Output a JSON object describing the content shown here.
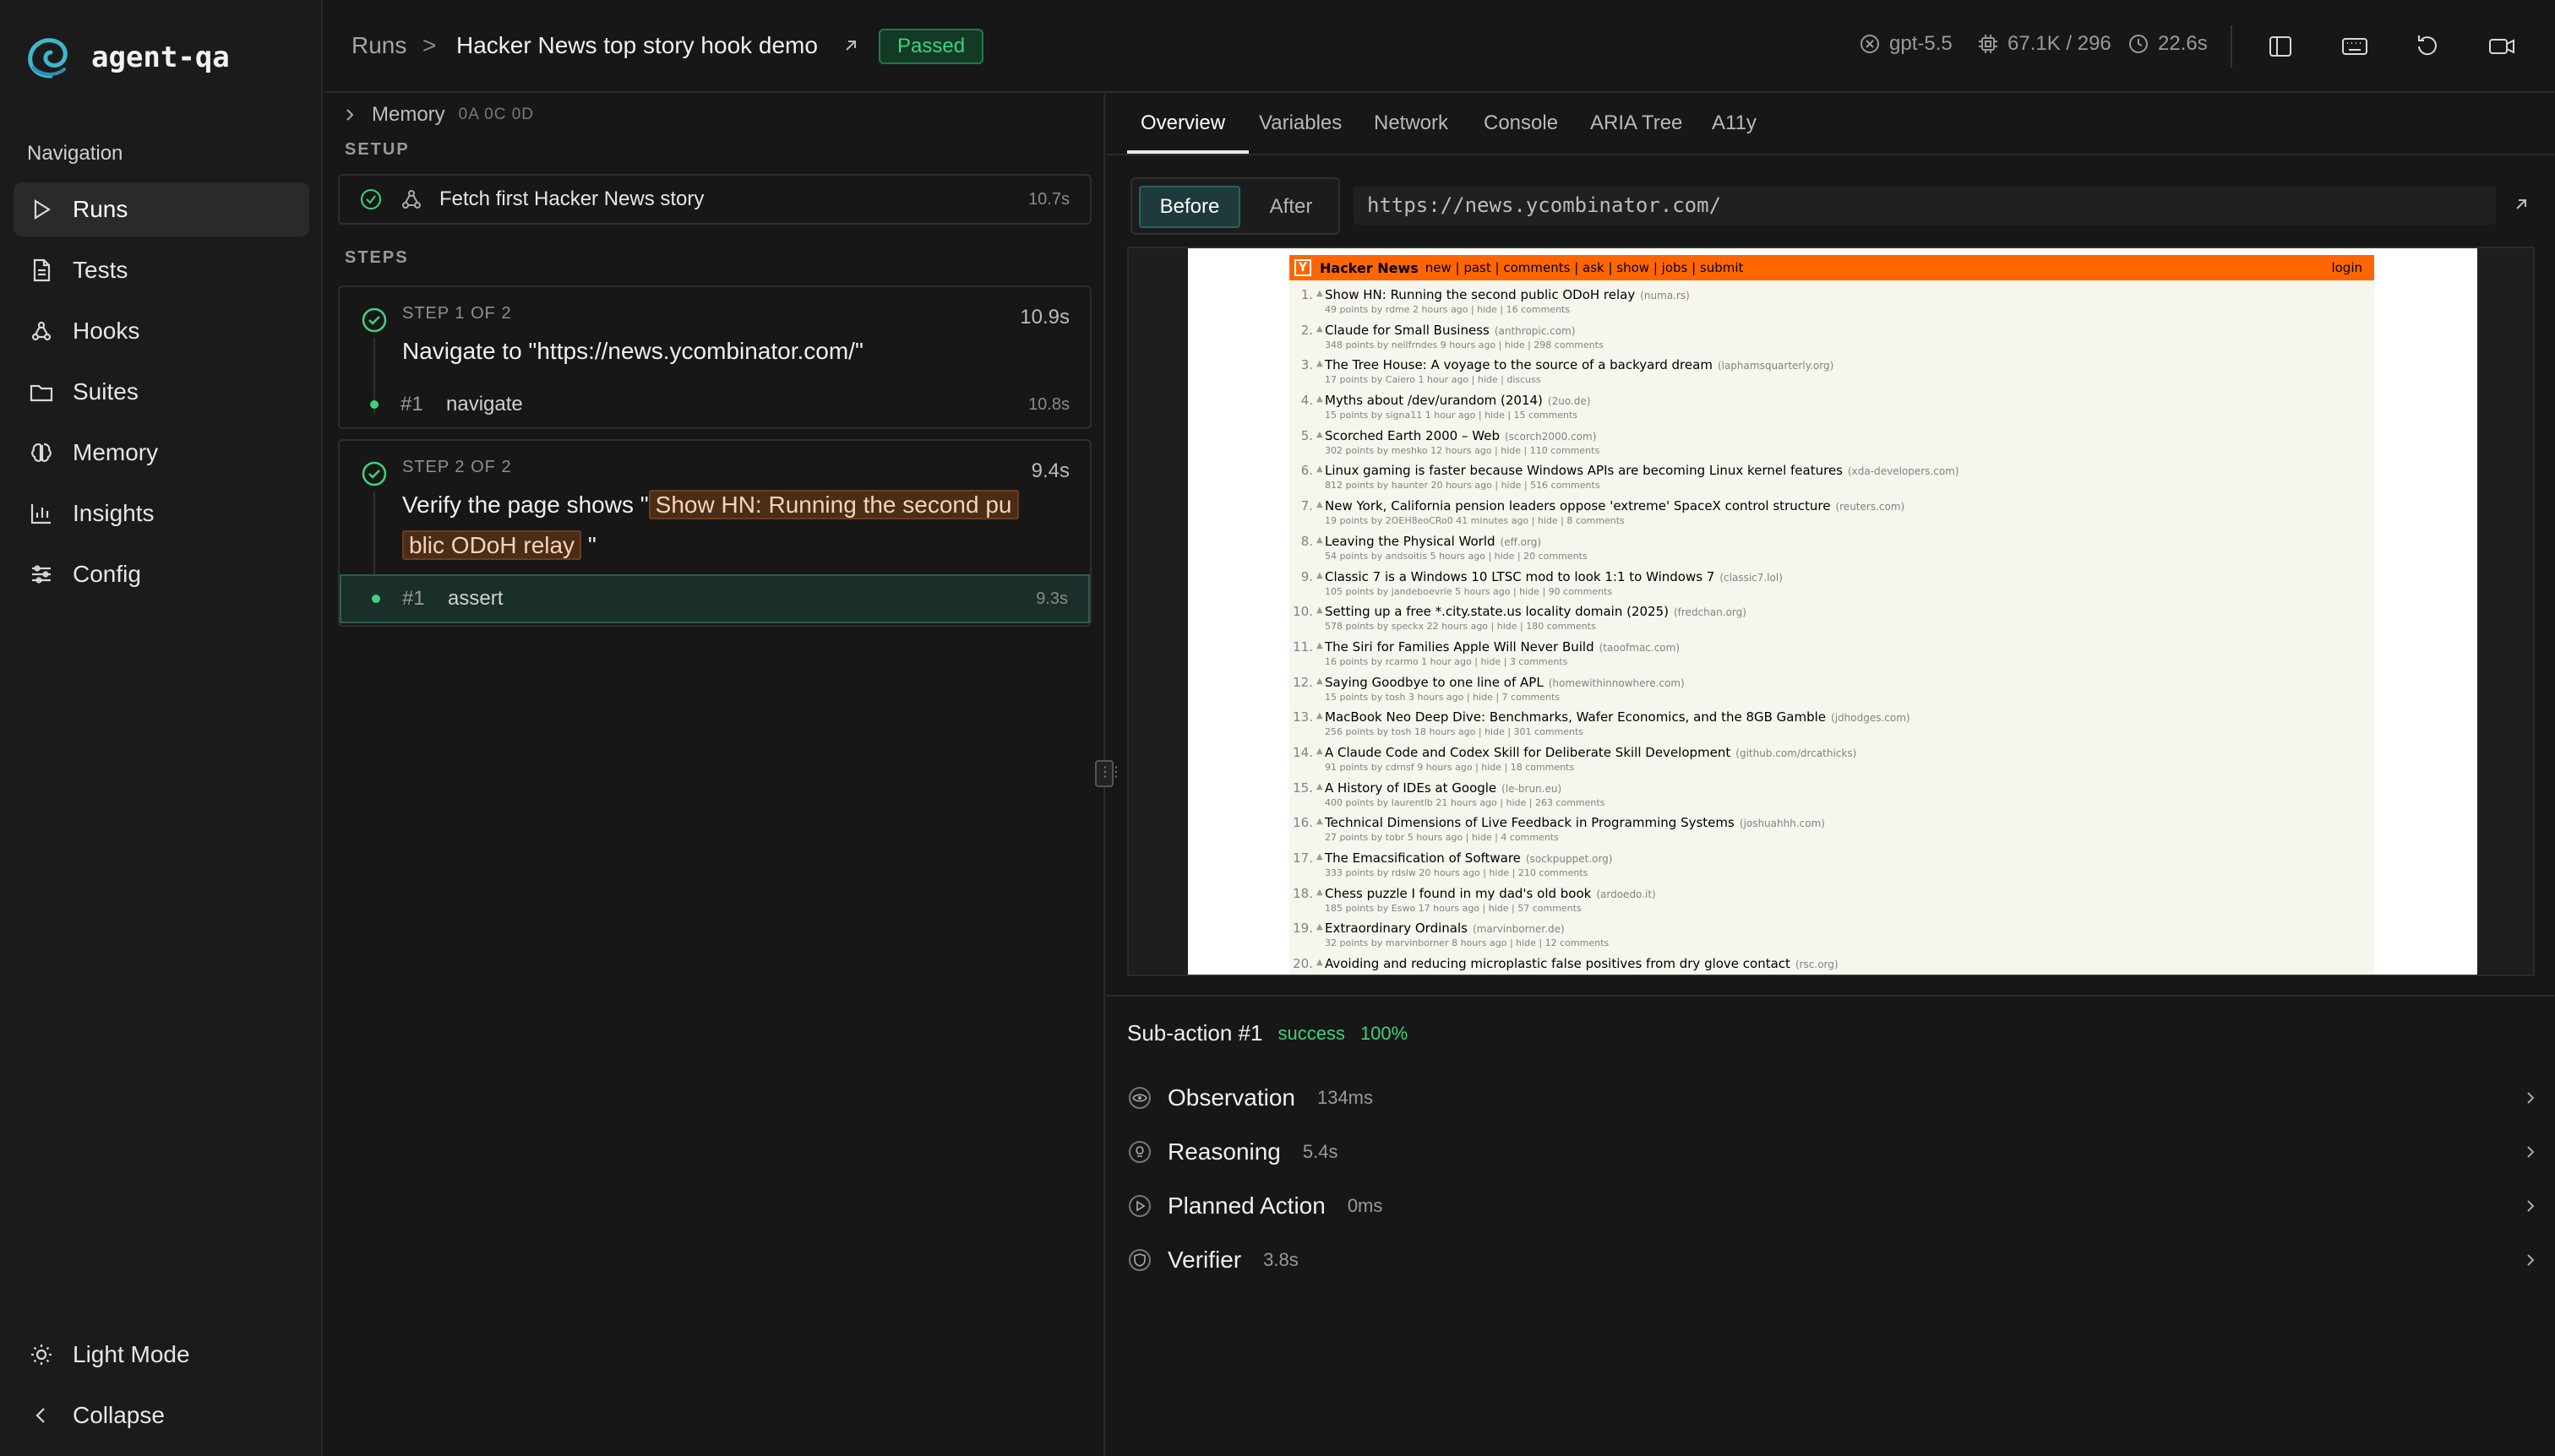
{
  "app": {
    "name": "agent-qa"
  },
  "sidebar": {
    "heading": "Navigation",
    "items": [
      {
        "label": "Runs",
        "icon": "play-icon",
        "active": true
      },
      {
        "label": "Tests",
        "icon": "file-icon"
      },
      {
        "label": "Hooks",
        "icon": "webhook-icon"
      },
      {
        "label": "Suites",
        "icon": "folder-icon"
      },
      {
        "label": "Memory",
        "icon": "brain-icon"
      },
      {
        "label": "Insights",
        "icon": "bar-chart-icon"
      },
      {
        "label": "Config",
        "icon": "sliders-icon"
      }
    ],
    "bottom": {
      "theme_label": "Light Mode",
      "collapse_label": "Collapse"
    }
  },
  "header": {
    "breadcrumb_root": "Runs",
    "breadcrumb_sep": ">",
    "title": "Hacker News top story hook demo",
    "status": "Passed",
    "model": "gpt-5.5",
    "tokens": "67.1K / 296",
    "duration": "22.6s"
  },
  "steps_panel": {
    "memory": {
      "label": "Memory",
      "ids": "0A 0C 0D"
    },
    "setup_label": "SETUP",
    "setup_item": {
      "label": "Fetch first Hacker News story",
      "time": "10.7s"
    },
    "steps_label": "STEPS",
    "steps": [
      {
        "label": "STEP 1 OF 2",
        "time": "10.9s",
        "title": "Navigate to \"https://news.ycombinator.com/\"",
        "sub": {
          "num": "#1",
          "name": "navigate",
          "time": "10.8s"
        }
      },
      {
        "label": "STEP 2 OF 2",
        "time": "9.4s",
        "title_prefix": "Verify the page shows \"",
        "title_highlight_1": "Show HN: Running the second pu",
        "title_highlight_2": "blic ODoH relay",
        "title_suffix": "\"",
        "sub": {
          "num": "#1",
          "name": "assert",
          "time": "9.3s"
        }
      }
    ]
  },
  "right_panel": {
    "tabs": [
      "Overview",
      "Variables",
      "Network",
      "Console",
      "ARIA Tree",
      "A11y"
    ],
    "before_label": "Before",
    "after_label": "After",
    "url": "https://news.ycombinator.com/",
    "hn": {
      "brand": "Hacker News",
      "links": "new | past | comments | ask | show | jobs | submit",
      "login": "login",
      "items": [
        {
          "rank": "1.",
          "title": "Show HN: Running the second public ODoH relay",
          "site": "(numa.rs)",
          "sub": "49 points by rdme 2 hours ago | hide | 16 comments"
        },
        {
          "rank": "2.",
          "title": "Claude for Small Business",
          "site": "(anthropic.com)",
          "sub": "348 points by neilfrndes 9 hours ago | hide | 298 comments"
        },
        {
          "rank": "3.",
          "title": "The Tree House: A voyage to the source of a backyard dream",
          "site": "(laphamsquarterly.org)",
          "sub": "17 points by Caiero 1 hour ago | hide | discuss"
        },
        {
          "rank": "4.",
          "title": "Myths about /dev/urandom (2014)",
          "site": "(2uo.de)",
          "sub": "15 points by signa11 1 hour ago | hide | 15 comments"
        },
        {
          "rank": "5.",
          "title": "Scorched Earth 2000 – Web",
          "site": "(scorch2000.com)",
          "sub": "302 points by meshko 12 hours ago | hide | 110 comments"
        },
        {
          "rank": "6.",
          "title": "Linux gaming is faster because Windows APIs are becoming Linux kernel features",
          "site": "(xda-developers.com)",
          "sub": "812 points by haunter 20 hours ago | hide | 516 comments"
        },
        {
          "rank": "7.",
          "title": "New York, California pension leaders oppose 'extreme' SpaceX control structure",
          "site": "(reuters.com)",
          "sub": "19 points by 2OEH8eoCRo0 41 minutes ago | hide | 8 comments"
        },
        {
          "rank": "8.",
          "title": "Leaving the Physical World",
          "site": "(eff.org)",
          "sub": "54 points by andsoitis 5 hours ago | hide | 20 comments"
        },
        {
          "rank": "9.",
          "title": "Classic 7 is a Windows 10 LTSC mod to look 1:1 to Windows 7",
          "site": "(classic7.lol)",
          "sub": "105 points by jandeboevrie 5 hours ago | hide | 90 comments"
        },
        {
          "rank": "10.",
          "title": "Setting up a free *.city.state.us locality domain (2025)",
          "site": "(fredchan.org)",
          "sub": "578 points by speckx 22 hours ago | hide | 180 comments"
        },
        {
          "rank": "11.",
          "title": "The Siri for Families Apple Will Never Build",
          "site": "(taoofmac.com)",
          "sub": "16 points by rcarmo 1 hour ago | hide | 3 comments"
        },
        {
          "rank": "12.",
          "title": "Saying Goodbye to one line of APL",
          "site": "(homewithinnowhere.com)",
          "sub": "15 points by tosh 3 hours ago | hide | 7 comments"
        },
        {
          "rank": "13.",
          "title": "MacBook Neo Deep Dive: Benchmarks, Wafer Economics, and the 8GB Gamble",
          "site": "(jdhodges.com)",
          "sub": "256 points by tosh 18 hours ago | hide | 301 comments"
        },
        {
          "rank": "14.",
          "title": "A Claude Code and Codex Skill for Deliberate Skill Development",
          "site": "(github.com/drcathicks)",
          "sub": "91 points by cdrnsf 9 hours ago | hide | 18 comments"
        },
        {
          "rank": "15.",
          "title": "A History of IDEs at Google",
          "site": "(le-brun.eu)",
          "sub": "400 points by laurentlb 21 hours ago | hide | 263 comments"
        },
        {
          "rank": "16.",
          "title": "Technical Dimensions of Live Feedback in Programming Systems",
          "site": "(joshuahhh.com)",
          "sub": "27 points by tobr 5 hours ago | hide | 4 comments"
        },
        {
          "rank": "17.",
          "title": "The Emacsification of Software",
          "site": "(sockpuppet.org)",
          "sub": "333 points by rdslw 20 hours ago | hide | 210 comments"
        },
        {
          "rank": "18.",
          "title": "Chess puzzle I found in my dad's old book",
          "site": "(ardoedo.it)",
          "sub": "185 points by Eswo 17 hours ago | hide | 57 comments"
        },
        {
          "rank": "19.",
          "title": "Extraordinary Ordinals",
          "site": "(marvinborner.de)",
          "sub": "32 points by marvinborner 8 hours ago | hide | 12 comments"
        },
        {
          "rank": "20.",
          "title": "Avoiding and reducing microplastic false positives from dry glove contact",
          "site": "(rsc.org)",
          "sub": ""
        }
      ]
    },
    "subaction": {
      "title": "Sub-action #1",
      "status": "success",
      "confidence": "100%",
      "rows": [
        {
          "label": "Observation",
          "time": "134ms",
          "icon": "eye-icon"
        },
        {
          "label": "Reasoning",
          "time": "5.4s",
          "icon": "lightbulb-icon"
        },
        {
          "label": "Planned Action",
          "time": "0ms",
          "icon": "play-circle-icon"
        },
        {
          "label": "Verifier",
          "time": "3.8s",
          "icon": "shield-check-icon"
        }
      ]
    }
  },
  "colors": {
    "accent_green": "#3fd17e",
    "hn_orange": "#ff6600",
    "highlight": "#4a2d18"
  }
}
